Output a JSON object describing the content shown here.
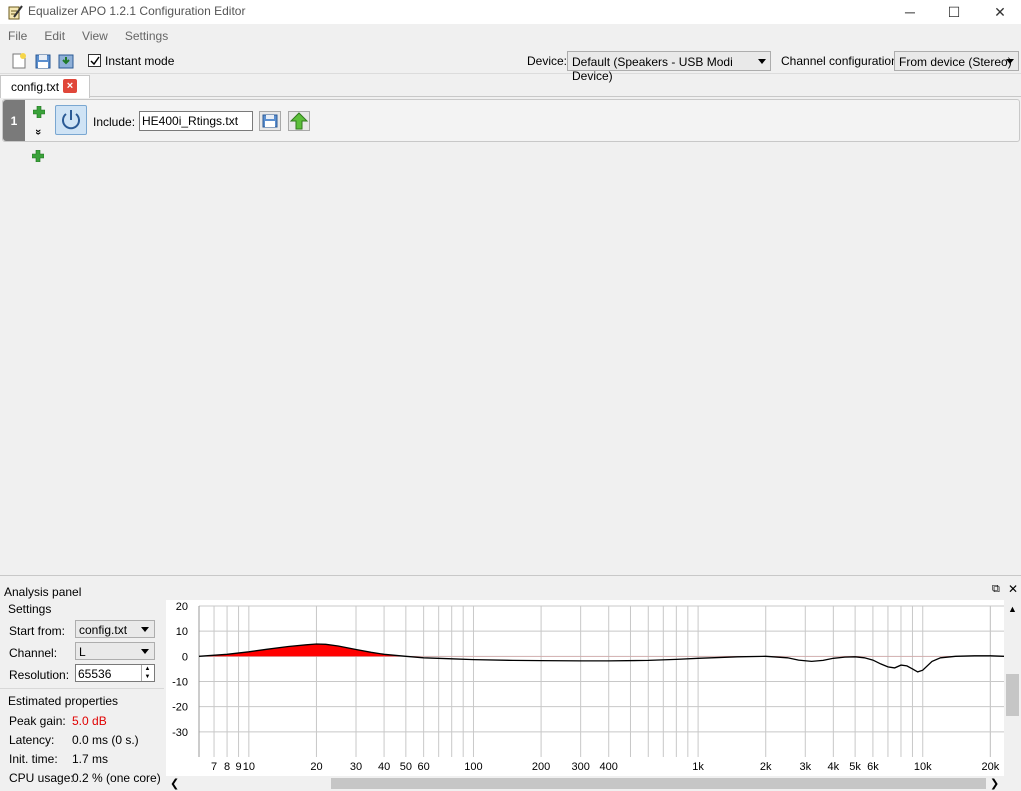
{
  "window": {
    "title": "Equalizer APO 1.2.1 Configuration Editor",
    "minimize_icon": "minimize-icon",
    "maximize_icon": "maximize-icon",
    "close_icon": "close-icon"
  },
  "menu": {
    "items": [
      "File",
      "Edit",
      "View",
      "Settings"
    ]
  },
  "toolbar": {
    "instant_mode_label": "Instant mode",
    "instant_mode_checked": true,
    "device_label": "Device:",
    "device_value": "Default (Speakers - USB Modi Device)",
    "channel_config_label": "Channel configuration:",
    "channel_config_value": "From device (Stereo)"
  },
  "tabs": [
    {
      "label": "config.txt",
      "close": "×"
    }
  ],
  "filters": [
    {
      "number": "1",
      "include_label": "Include:",
      "include_value": "HE400i_Rtings.txt",
      "expand_glyph": "»"
    }
  ],
  "analysis": {
    "title": "Analysis panel",
    "settings_title": "Settings",
    "start_from_label": "Start from:",
    "start_from_value": "config.txt",
    "channel_label": "Channel:",
    "channel_value": "L",
    "resolution_label": "Resolution:",
    "resolution_value": "65536",
    "estimated_title": "Estimated properties",
    "peak_gain_label": "Peak gain:",
    "peak_gain_value": "5.0 dB",
    "latency_label": "Latency:",
    "latency_value": "0.0 ms (0 s.)",
    "init_time_label": "Init. time:",
    "init_time_value": "1.7 ms",
    "cpu_label": "CPU usage:",
    "cpu_value": "0.2 % (one core)",
    "peak_color": "#e00000"
  },
  "chart_data": {
    "type": "line",
    "title": "",
    "xlabel": "",
    "ylabel": "",
    "x_scale": "log",
    "xlim": [
      6,
      23000
    ],
    "ylim": [
      -40,
      20
    ],
    "y_ticks": [
      20,
      10,
      0,
      -10,
      -20,
      -30
    ],
    "x_tick_labels": [
      {
        "v": 7,
        "t": "7"
      },
      {
        "v": 8,
        "t": "8"
      },
      {
        "v": 9,
        "t": "9"
      },
      {
        "v": 10,
        "t": "10"
      },
      {
        "v": 20,
        "t": "20"
      },
      {
        "v": 30,
        "t": "30"
      },
      {
        "v": 40,
        "t": "40"
      },
      {
        "v": 50,
        "t": "50"
      },
      {
        "v": 60,
        "t": "60"
      },
      {
        "v": 100,
        "t": "100"
      },
      {
        "v": 200,
        "t": "200"
      },
      {
        "v": 300,
        "t": "300"
      },
      {
        "v": 400,
        "t": "400"
      },
      {
        "v": 1000,
        "t": "1k"
      },
      {
        "v": 2000,
        "t": "2k"
      },
      {
        "v": 3000,
        "t": "3k"
      },
      {
        "v": 4000,
        "t": "4k"
      },
      {
        "v": 5000,
        "t": "5k"
      },
      {
        "v": 6000,
        "t": "6k"
      },
      {
        "v": 10000,
        "t": "10k"
      },
      {
        "v": 20000,
        "t": "20k"
      }
    ],
    "grid": true,
    "positive_fill_color": "#ff0000",
    "series": [
      {
        "x": [
          6,
          8,
          10,
          12,
          15,
          18,
          20,
          22,
          25,
          30,
          35,
          40,
          50,
          60,
          80,
          100,
          150,
          200,
          300,
          400,
          600,
          800,
          1000,
          1500,
          2000,
          2500,
          2800,
          3200,
          3600,
          4000,
          4500,
          5000,
          5500,
          6000,
          6500,
          7000,
          7500,
          8000,
          8500,
          9000,
          9500,
          10000,
          11000,
          12000,
          14000,
          17000,
          20000,
          23000
        ],
        "y": [
          0,
          0.8,
          1.8,
          2.8,
          3.9,
          4.6,
          4.9,
          4.8,
          4.1,
          2.7,
          1.6,
          0.8,
          0,
          -0.6,
          -1.0,
          -1.3,
          -1.6,
          -1.7,
          -1.8,
          -1.8,
          -1.6,
          -1.2,
          -0.8,
          -0.2,
          0,
          -0.6,
          -1.5,
          -2.0,
          -1.6,
          -0.8,
          -0.3,
          -0.2,
          -0.6,
          -1.5,
          -3.0,
          -4.2,
          -4.6,
          -3.5,
          -3.8,
          -5.0,
          -6.2,
          -5.5,
          -2.0,
          -0.6,
          0,
          0.2,
          0.2,
          0
        ]
      }
    ]
  }
}
